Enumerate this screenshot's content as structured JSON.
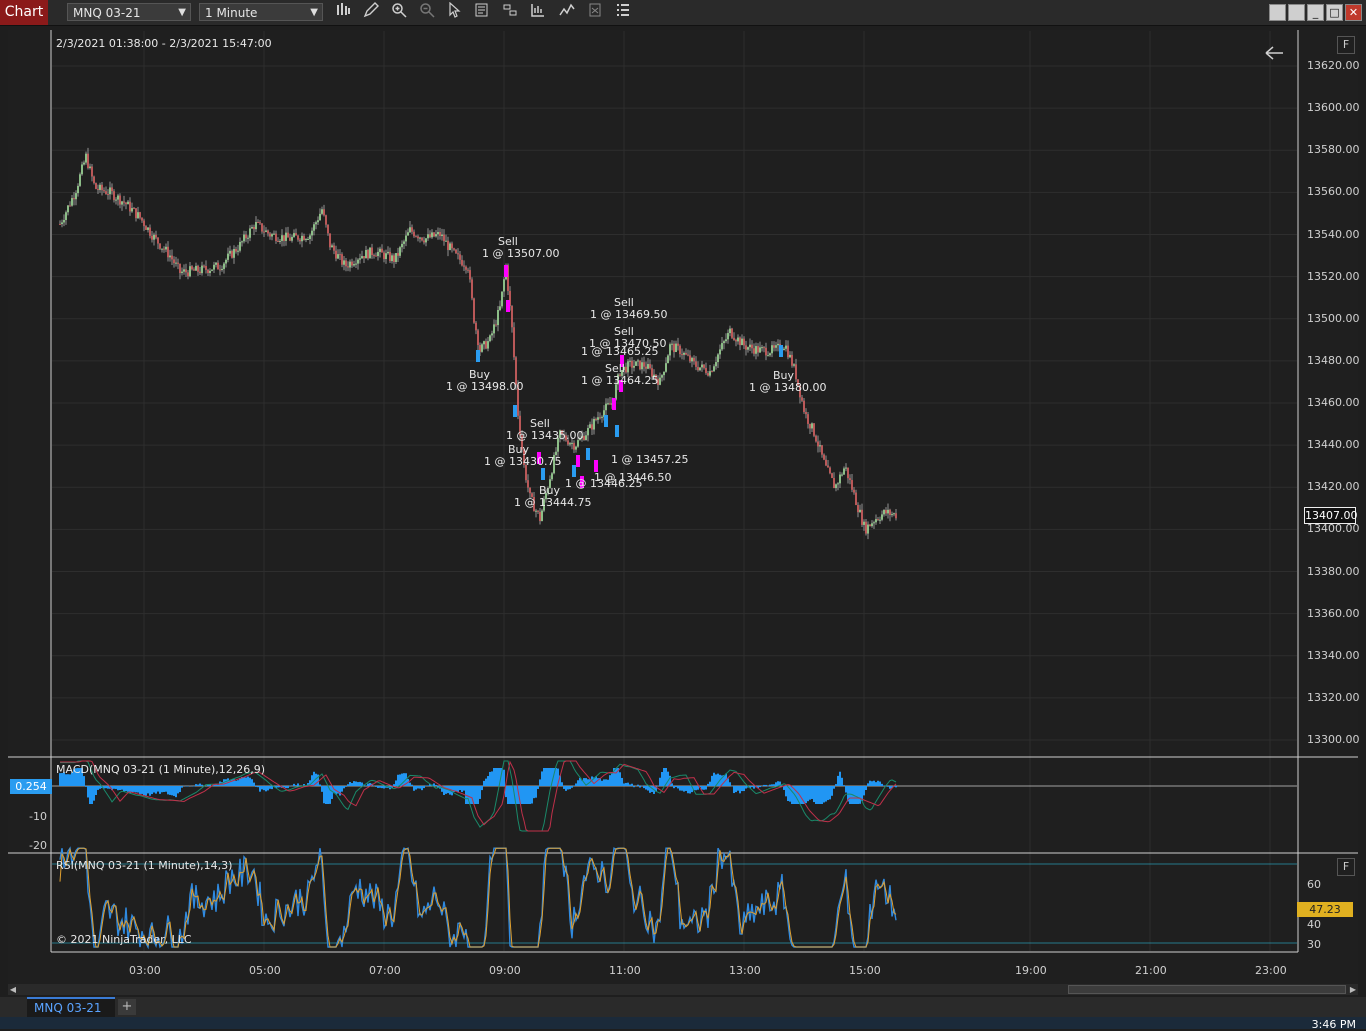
{
  "window": {
    "title": "Chart",
    "instrument": "MNQ 03-21",
    "interval": "1 Minute"
  },
  "price_pane": {
    "date_range": "2/3/2021 01:38:00 - 2/3/2021 15:47:00",
    "f_button": "F",
    "last_price": "13407.00",
    "price_ticks": [
      "13620.00",
      "13600.00",
      "13580.00",
      "13560.00",
      "13540.00",
      "13520.00",
      "13500.00",
      "13480.00",
      "13460.00",
      "13440.00",
      "13420.00",
      "13400.00",
      "13380.00",
      "13360.00",
      "13340.00",
      "13320.00",
      "13300.00"
    ],
    "trade_labels": [
      {
        "text": "Sell"
      },
      {
        "text": "1 @ 13507.00"
      },
      {
        "text": "Buy"
      },
      {
        "text": "1 @ 13498.00"
      },
      {
        "text": "Sell"
      },
      {
        "text": "1 @ 13469.50"
      },
      {
        "text": "Sell"
      },
      {
        "text": "1 @ 13470.50"
      },
      {
        "text": "1 @ 13465.25"
      },
      {
        "text": "Sell"
      },
      {
        "text": "1 @ 13464.25"
      },
      {
        "text": "Buy"
      },
      {
        "text": "1 @ 13480.00"
      },
      {
        "text": "Sell"
      },
      {
        "text": "1 @ 13435.00"
      },
      {
        "text": "Buy"
      },
      {
        "text": "1 @ 13430.75"
      },
      {
        "text": "Buy"
      },
      {
        "text": "1 @ 13444.75"
      },
      {
        "text": "1 @ 13446.25"
      },
      {
        "text": "1 @ 13446.50"
      },
      {
        "text": "1 @ 13457.25"
      }
    ]
  },
  "macd_pane": {
    "label": "MACD(MNQ 03-21 (1 Minute),12,26,9)",
    "value_tag": "0.254",
    "ticks": [
      "-10",
      "-20"
    ]
  },
  "rsi_pane": {
    "label": "RSI(MNQ 03-21 (1 Minute),14,3)",
    "value_tag": "47.23",
    "f_button": "F",
    "ticks": [
      "60",
      "40",
      "30"
    ],
    "copyright": "© 2021 NinjaTrader, LLC"
  },
  "time_axis": [
    "03:00",
    "05:00",
    "07:00",
    "09:00",
    "11:00",
    "13:00",
    "15:00",
    "19:00",
    "21:00",
    "23:00"
  ],
  "tabs": {
    "active": "MNQ 03-21",
    "add": "+"
  },
  "taskbar": {
    "clock": "3:46 PM"
  },
  "colors": {
    "bull": "#a8e6a1",
    "bear": "#e06666",
    "macd_hist": "#2196f3",
    "macd_line": "#1a8a6a",
    "macd_signal": "#c0304a",
    "rsi_line": "#2f8ae0",
    "rsi_avg": "#e0a030",
    "sell_marker": "#ff00ff",
    "buy_marker": "#2a9cf0",
    "rsi_tag": "#e0b020",
    "macd_tag": "#2a9cf0"
  },
  "icons": [
    "bar-type-icon",
    "pencil-icon",
    "zoom-in-icon",
    "zoom-out-icon",
    "pointer-icon",
    "properties-icon",
    "data-box-icon",
    "strategies-icon",
    "indicators-icon",
    "templates-icon",
    "menu-icon"
  ]
}
